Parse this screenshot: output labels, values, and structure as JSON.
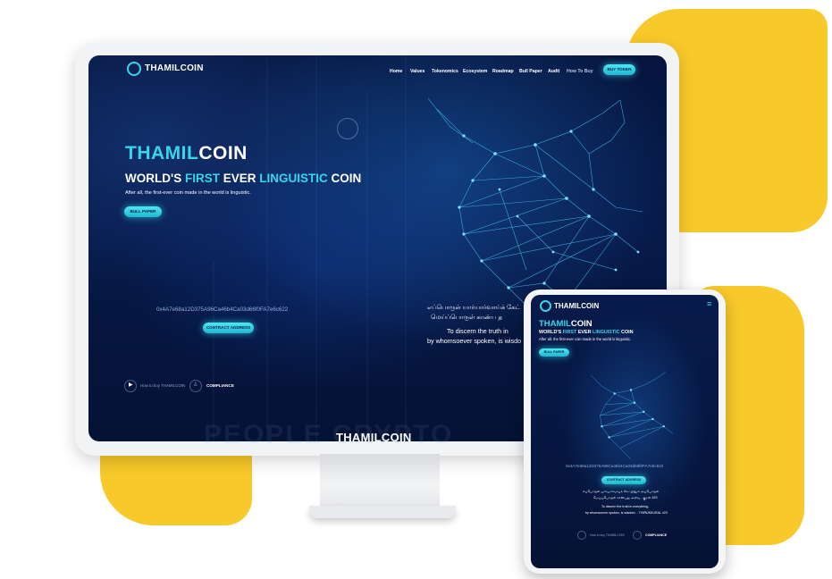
{
  "brand": {
    "name": "THAMILCOIN",
    "hero_part1": "THAMIL",
    "hero_part2": "COIN"
  },
  "nav": [
    {
      "label": "Home"
    },
    {
      "label": "Values"
    },
    {
      "label": "Tokenomics"
    },
    {
      "label": "Ecosystem"
    },
    {
      "label": "Roadmap"
    },
    {
      "label": "Bull Paper"
    },
    {
      "label": "Audit"
    },
    {
      "label": "How To Buy"
    }
  ],
  "nav_cta": "BUY TOKEN",
  "hero": {
    "h_part1": "WORLD'S ",
    "h_part2": "FIRST",
    "h_part3": " EVER ",
    "h_part4": "LINGUISTIC",
    "h_part5": " COIN",
    "subtitle": "After all, the first-ever coin made in the world is linguistic.",
    "button": "BULL PAPER"
  },
  "contract": {
    "address": "0x4A7e68a12D375A96Ca46b4Ca03d66f0FA7e6c622",
    "button": "CONTRACT ADDRESS"
  },
  "quote": {
    "tamil_line1": "எப்பொருள் யார்யார்வாய்க் கேட்",
    "tamil_line2": "மெய்ப்பொருள் காண்ப த",
    "english_line1": "To discern the truth in",
    "english_line2": "by whomsoever spoken, is wisdo"
  },
  "footer_links": {
    "how_to_buy": "How to buy THAMILCOIN",
    "compliance": "COMPLIANCE"
  },
  "bottom_brand": "THAMILCOIN",
  "ghost_text": "PEOPLE CRYPTO",
  "tablet": {
    "hero_part1": "THAMIL",
    "hero_part2": "COIN",
    "address": "0x4A7e68a12D375A96Ca46b4Ca03d66f0FA7e6c622",
    "tamil_line1": "எப்பொருள் யார்யார்வாய்க் கேட்பினும் அப்பொருள்",
    "tamil_line2": "மெய்ப்பொருள் காண்பது அறிவு - குறள் 423",
    "english_line1": "To discern the truth in everything,",
    "english_line2": "by whomsoever spoken, is wisdom. - THIRUKKURAL 423"
  },
  "colors": {
    "accent": "#35d6ea",
    "screen_bg": "#06163f",
    "frame_yellow": "#f8c92a"
  },
  "icons": [
    "logo-icon",
    "play-icon",
    "shield-icon",
    "menu-icon",
    "bull-graphic"
  ]
}
